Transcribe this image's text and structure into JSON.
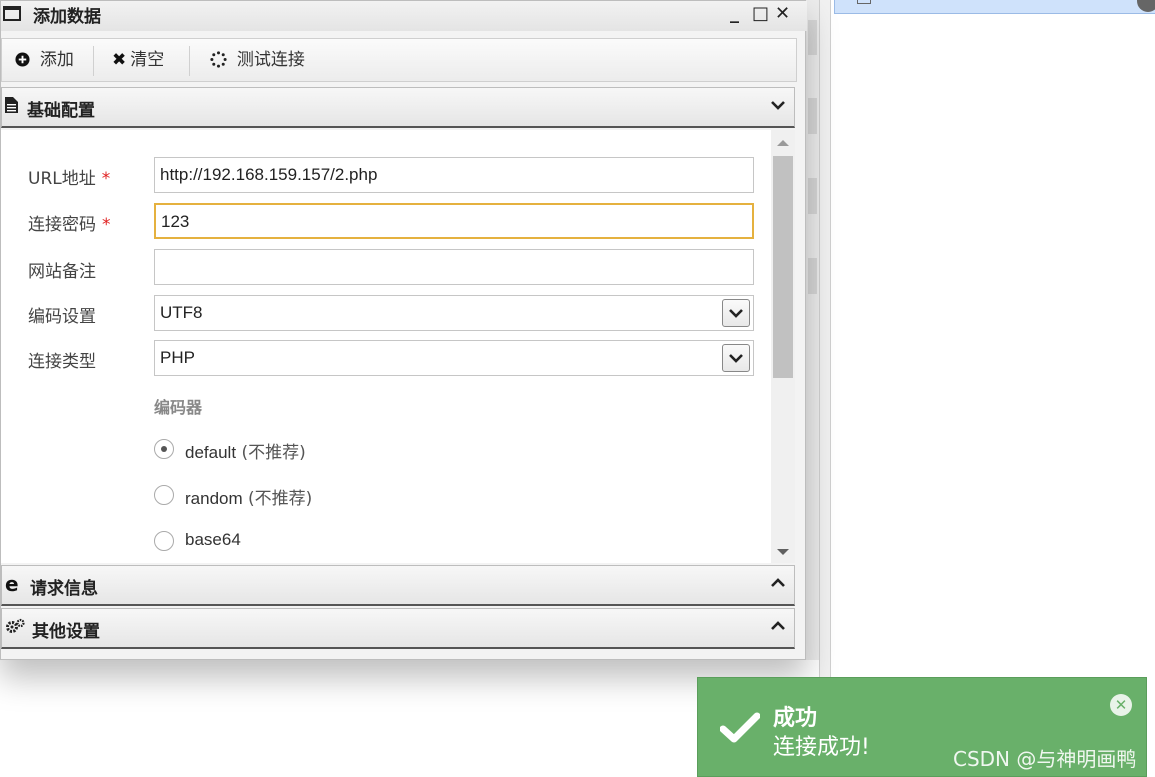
{
  "window": {
    "title": "添加数据",
    "minimize_glyph": "_",
    "maximize_glyph": "□",
    "close_glyph": "✕"
  },
  "toolbar": {
    "add_label": "添加",
    "clear_label": "清空",
    "test_label": "测试连接"
  },
  "panels": {
    "basic": "基础配置",
    "request": "请求信息",
    "other": "其他设置"
  },
  "form": {
    "url_label": "URL地址",
    "url_value": "http://192.168.159.157/2.php",
    "password_label": "连接密码",
    "password_value": "123",
    "note_label": "网站备注",
    "note_value": "",
    "encoding_label": "编码设置",
    "encoding_value": "UTF8",
    "type_label": "连接类型",
    "type_value": "PHP",
    "encoder_label": "编码器",
    "required_mark": "*",
    "encoders": [
      {
        "name": "default",
        "note": " (不推荐)",
        "checked": true
      },
      {
        "name": "random",
        "note": " (不推荐)",
        "checked": false
      },
      {
        "name": "base64",
        "note": "",
        "checked": false
      }
    ]
  },
  "toast": {
    "title": "成功",
    "message": "连接成功!"
  },
  "watermark": "CSDN @与神明画鸭",
  "colors": {
    "toast_bg": "#69b06a",
    "focus_border": "#e5b13f",
    "required": "#e02020"
  }
}
